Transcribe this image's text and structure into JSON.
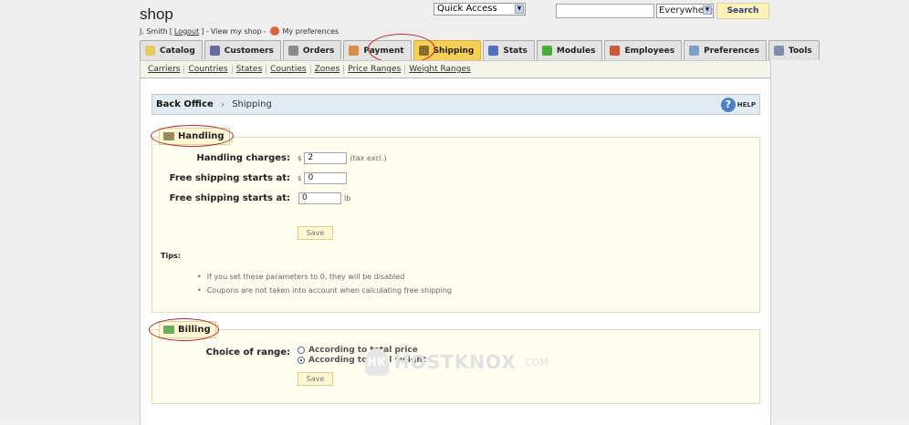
{
  "header": {
    "shop_title": "shop",
    "user_name": "J. Smith",
    "logout_label": "Logout",
    "view_shop_label": "View my shop",
    "preferences_label": "My preferences"
  },
  "quick_access": {
    "selected": "Quick Access"
  },
  "search": {
    "scope_selected": "Everywhere",
    "button_label": "Search",
    "value": ""
  },
  "tabs": [
    {
      "label": "Catalog",
      "icon": "folder-icon",
      "color": "#e8c95a"
    },
    {
      "label": "Customers",
      "icon": "customer-icon",
      "color": "#6b6b9f"
    },
    {
      "label": "Orders",
      "icon": "cart-icon",
      "color": "#8a8a8a"
    },
    {
      "label": "Payment",
      "icon": "payment-icon",
      "color": "#d68b4a"
    },
    {
      "label": "Shipping",
      "icon": "truck-icon",
      "color": "#8a6e2f",
      "active": true
    },
    {
      "label": "Stats",
      "icon": "chart-icon",
      "color": "#4d70c0"
    },
    {
      "label": "Modules",
      "icon": "puzzle-icon",
      "color": "#4daa3c"
    },
    {
      "label": "Employees",
      "icon": "employee-icon",
      "color": "#c65a3a"
    },
    {
      "label": "Preferences",
      "icon": "preferences-icon",
      "color": "#7aa0c8"
    },
    {
      "label": "Tools",
      "icon": "wrench-icon",
      "color": "#7f8da8"
    }
  ],
  "subnav": [
    "Carriers",
    "Countries",
    "States",
    "Counties",
    "Zones",
    "Price Ranges",
    "Weight Ranges"
  ],
  "breadcrumb": {
    "root": "Back Office",
    "current": "Shipping",
    "help_label": "HELP"
  },
  "handling": {
    "legend": "Handling",
    "handling_label": "Handling charges:",
    "handling_currency": "$",
    "handling_value": "2",
    "handling_note": "(tax excl.)",
    "free_price_label": "Free shipping starts at:",
    "free_price_currency": "$",
    "free_price_value": "0",
    "free_weight_label": "Free shipping starts at:",
    "free_weight_value": "0",
    "free_weight_unit": "lb",
    "save_label": "Save",
    "tips_title": "Tips:",
    "tips": [
      "If you set these parameters to 0, they will be disabled",
      "Coupons are not taken into account when calculating free shipping"
    ]
  },
  "billing": {
    "legend": "Billing",
    "range_label": "Choice of range:",
    "option_price": "According to total price",
    "option_weight": "According to total weight",
    "selected": "weight",
    "save_label": "Save"
  },
  "watermark": {
    "text": "HOSTKNOX",
    "suffix": ".COM",
    "badge": "HK"
  },
  "colors": {
    "active_tab": "#f7cf53",
    "highlight_oval": "#b02a2a"
  }
}
